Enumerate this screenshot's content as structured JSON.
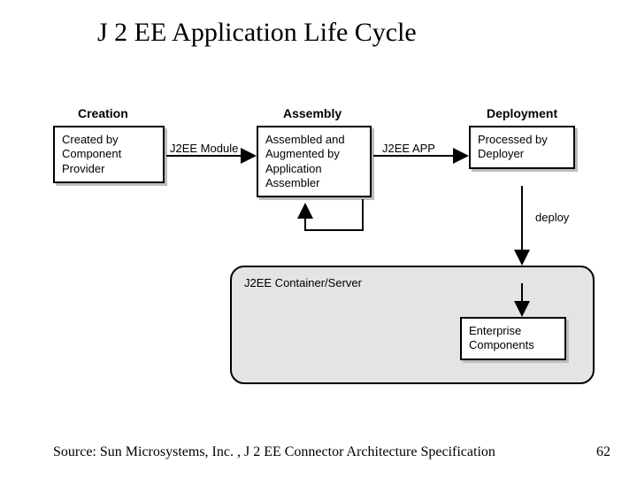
{
  "title": "J 2 EE Application Life Cycle",
  "phases": {
    "creation": "Creation",
    "assembly": "Assembly",
    "deployment": "Deployment"
  },
  "boxes": {
    "creation_body": "Created by Component Provider",
    "assembly_body": "Assembled and Augmented by Application Assembler",
    "deployment_body": "Processed by Deployer",
    "enterprise_components": "Enterprise Components"
  },
  "arrows": {
    "module": "J2EE Module",
    "app": "J2EE APP",
    "deploy": "deploy"
  },
  "container_label": "J2EE Container/Server",
  "source": "Source: Sun Microsystems, Inc. , J 2 EE Connector Architecture Specification",
  "page": "62"
}
